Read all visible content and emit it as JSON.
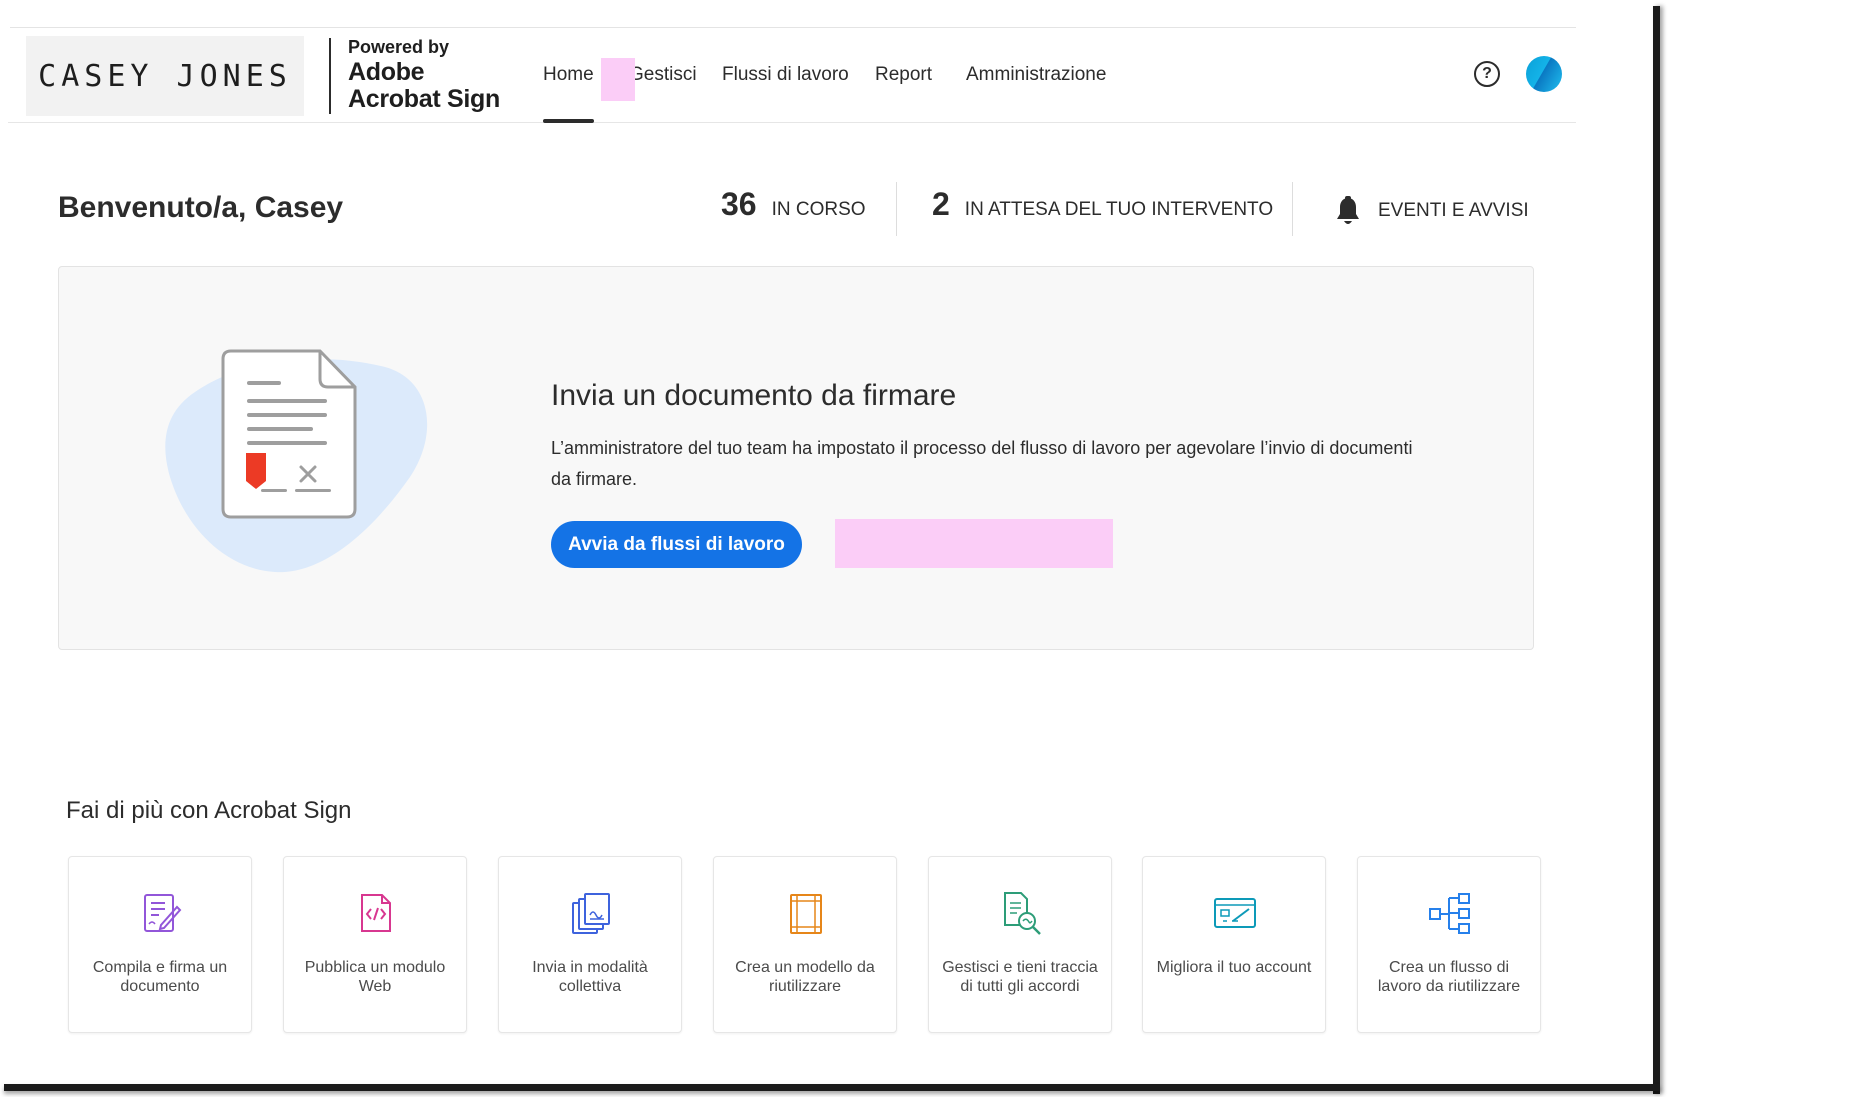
{
  "header": {
    "brand_logo_text": "CASEY JONES",
    "powered_by": "Powered by",
    "product_line1": "Adobe",
    "product_line2": "Acrobat Sign",
    "nav": [
      {
        "label": "Home",
        "active": true
      },
      {
        "label": "Gestisci"
      },
      {
        "label": "Flussi di lavoro"
      },
      {
        "label": "Report"
      },
      {
        "label": "Amministrazione"
      }
    ],
    "help_icon": "question-circle-icon",
    "avatar_color": "#1aa7e0"
  },
  "welcome": {
    "greeting": "Benvenuto/a, Casey",
    "in_progress_count": "36",
    "in_progress_label": "IN CORSO",
    "waiting_count": "2",
    "waiting_label": "IN ATTESA DEL TUO INTERVENTO",
    "events_label": "EVENTI E AVVISI"
  },
  "hero": {
    "title": "Invia un documento da firmare",
    "description": "L’amministratore del tuo team ha impostato il processo del flusso di lavoro per agevolare l’invio di documenti da firmare.",
    "button_label": "Avvia da flussi di lavoro",
    "button_color": "#1473e6"
  },
  "more": {
    "title": "Fai di più con Acrobat Sign",
    "tiles": [
      {
        "label": "Compila e firma un documento",
        "icon": "fill-sign-icon",
        "color": "#9256d9"
      },
      {
        "label": "Pubblica un modulo Web",
        "icon": "web-form-icon",
        "color": "#d83790"
      },
      {
        "label": "Invia in modalità collettiva",
        "icon": "bulk-send-icon",
        "color": "#3e63dd"
      },
      {
        "label": "Crea un modello da riutilizzare",
        "icon": "template-icon",
        "color": "#e68619"
      },
      {
        "label": "Gestisci e tieni traccia di tutti gli accordi",
        "icon": "manage-track-icon",
        "color": "#2d9d78"
      },
      {
        "label": "Migliora il tuo account",
        "icon": "account-upgrade-icon",
        "color": "#0d9ab8"
      },
      {
        "label": "Crea un flusso di lavoro da riutilizzare",
        "icon": "workflow-icon",
        "color": "#2680eb"
      }
    ]
  }
}
